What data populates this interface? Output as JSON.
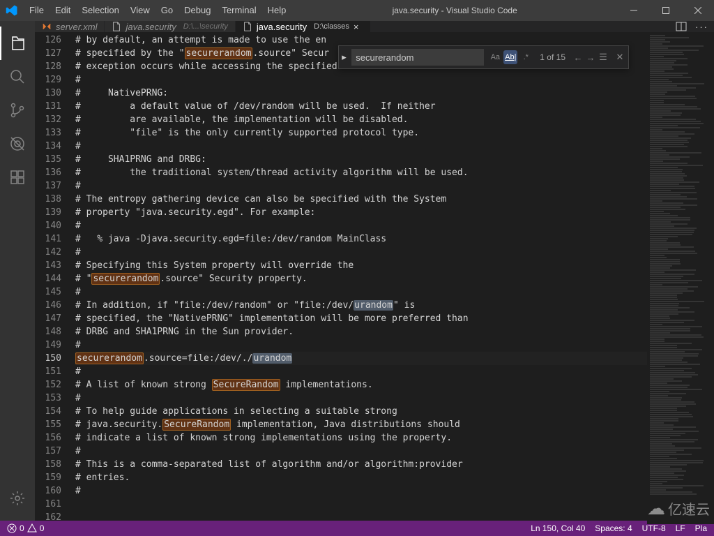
{
  "window": {
    "title": "java.security - Visual Studio Code"
  },
  "menu": [
    "File",
    "Edit",
    "Selection",
    "View",
    "Go",
    "Debug",
    "Terminal",
    "Help"
  ],
  "tabs": [
    {
      "icon": "xml",
      "label": "server.xml",
      "path": "",
      "active": false
    },
    {
      "icon": "file",
      "label": "java.security",
      "path": "D:\\...\\security",
      "active": false
    },
    {
      "icon": "file",
      "label": "java.security",
      "path": "D:\\classes",
      "active": true
    }
  ],
  "find": {
    "value": "securerandom",
    "count": "1 of 15",
    "opts": {
      "case": "Aa",
      "word": "Ab|",
      "regex": ".*"
    }
  },
  "code": {
    "start": 126,
    "active": 150,
    "lines": [
      "# by default, an attempt is made to use the en",
      "# specified by the \"securerandom.source\" Secur",
      "# exception occurs while accessing the specified URL:",
      "#",
      "#     NativePRNG:",
      "#         a default value of /dev/random will be used.  If neither",
      "#         are available, the implementation will be disabled.",
      "#         \"file\" is the only currently supported protocol type.",
      "#",
      "#     SHA1PRNG and DRBG:",
      "#         the traditional system/thread activity algorithm will be used.",
      "#",
      "# The entropy gathering device can also be specified with the System",
      "# property \"java.security.egd\". For example:",
      "#",
      "#   % java -Djava.security.egd=file:/dev/random MainClass",
      "#",
      "# Specifying this System property will override the",
      "# \"securerandom.source\" Security property.",
      "#",
      "# In addition, if \"file:/dev/random\" or \"file:/dev/urandom\" is",
      "# specified, the \"NativePRNG\" implementation will be more preferred than",
      "# DRBG and SHA1PRNG in the Sun provider.",
      "#",
      "securerandom.source=file:/dev/./urandom",
      "",
      "#",
      "# A list of known strong SecureRandom implementations.",
      "#",
      "# To help guide applications in selecting a suitable strong",
      "# java.security.SecureRandom implementation, Java distributions should",
      "# indicate a list of known strong implementations using the property.",
      "#",
      "# This is a comma-separated list of algorithm and/or algorithm:provider",
      "# entries.",
      "#",
      ""
    ],
    "highlights": {
      "search": [
        "securerandom",
        "SecureRandom"
      ],
      "cur": [
        "urandom"
      ]
    }
  },
  "status": {
    "errors": "0",
    "warnings": "0",
    "cursor": "Ln 150, Col 40",
    "spaces": "Spaces: 4",
    "encoding": "UTF-8",
    "eol": "LF",
    "lang": "Pla"
  },
  "watermark": "亿速云"
}
